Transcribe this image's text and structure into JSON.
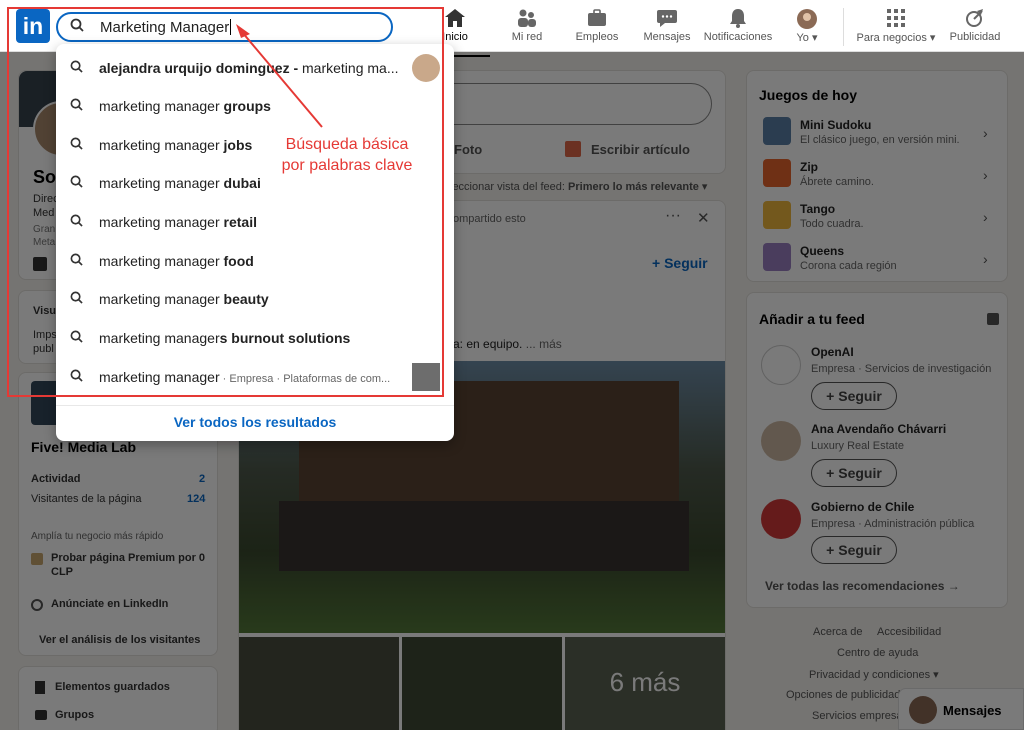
{
  "search": {
    "value": "Marketing Manager"
  },
  "nav": {
    "items": [
      {
        "label": "Inicio",
        "icon": "home-icon"
      },
      {
        "label": "Mi red",
        "icon": "network-icon"
      },
      {
        "label": "Empleos",
        "icon": "briefcase-icon"
      },
      {
        "label": "Mensajes",
        "icon": "chat-icon"
      },
      {
        "label": "Notificaciones",
        "icon": "bell-icon"
      },
      {
        "label": "Yo",
        "icon": "avatar-icon"
      },
      {
        "label": "Para negocios",
        "icon": "grid-icon"
      },
      {
        "label": "Publicidad",
        "icon": "compass-icon"
      }
    ]
  },
  "dropdown": {
    "suggestions": [
      {
        "prefix": "alejandra urquijo dominguez - ",
        "bold": "",
        "rest": "marketing ma...",
        "sub": ""
      },
      {
        "prefix": "marketing manager ",
        "bold": "groups",
        "rest": "",
        "sub": ""
      },
      {
        "prefix": "marketing manager ",
        "bold": "jobs",
        "rest": "",
        "sub": ""
      },
      {
        "prefix": "marketing manager ",
        "bold": "dubai",
        "rest": "",
        "sub": ""
      },
      {
        "prefix": "marketing manager ",
        "bold": "retail",
        "rest": "",
        "sub": ""
      },
      {
        "prefix": "marketing manager ",
        "bold": "food",
        "rest": "",
        "sub": ""
      },
      {
        "prefix": "marketing manager ",
        "bold": "beauty",
        "rest": "",
        "sub": ""
      },
      {
        "prefix": "marketing manager",
        "bold": "s burnout solutions",
        "rest": "",
        "sub": ""
      },
      {
        "prefix": "marketing manager",
        "bold": "",
        "rest": "",
        "sub": " · Empresa · Plataformas de com..."
      }
    ],
    "see_all": "Ver todos los resultados"
  },
  "annotation": "Búsqueda básica por palabras clave",
  "left": {
    "profile_name_partial": "So",
    "lines": [
      "Direc",
      "Med",
      "Gran",
      "Meta"
    ],
    "visu": "Visu",
    "imp": "Imps",
    "publ": "publ",
    "page_name": "Five! Media Lab",
    "activity_label": "Actividad",
    "activity_value": "2",
    "visitors_label": "Visitantes de la página",
    "visitors_value": "124",
    "grow_label": "Amplía tu negocio más rápido",
    "premium": "Probar página Premium por 0 CLP",
    "advertise": "Anúnciate en LinkedIn",
    "analysis": "Ver el análisis de los visitantes",
    "saved": "Elementos guardados",
    "groups": "Grupos"
  },
  "center": {
    "photo": "Foto",
    "article": "Escribir artículo",
    "feed_sort_label": "leccionar vista del feed:",
    "feed_sort_value": "Primero lo más relevante",
    "shared": "ompartido esto",
    "follow": "+ Seguir",
    "post_text": "a: en equipo.",
    "more": "... más",
    "more_photos": "6 más"
  },
  "right": {
    "games_title": "Juegos de hoy",
    "games": [
      {
        "name": "Mini Sudoku",
        "desc": "El clásico juego, en versión mini.",
        "color": "#5b7fa8"
      },
      {
        "name": "Zip",
        "desc": "Ábrete camino.",
        "color": "#e8642c"
      },
      {
        "name": "Tango",
        "desc": "Todo cuadra.",
        "color": "#f1b93d"
      },
      {
        "name": "Queens",
        "desc": "Corona cada región",
        "color": "#9b7fc3"
      }
    ],
    "feed_title": "Añadir a tu feed",
    "recs": [
      {
        "name": "OpenAI",
        "desc": "Empresa · Servicios de investigación",
        "follow": "+ Seguir"
      },
      {
        "name": "Ana Avendaño Chávarri",
        "desc": "Luxury Real Estate",
        "follow": "+ Seguir"
      },
      {
        "name": "Gobierno de Chile",
        "desc": "Empresa · Administración pública",
        "follow": "+ Seguir"
      }
    ],
    "see_all_recs": "Ver todas las recomendaciones →",
    "footer": [
      "Acerca de",
      "Accesibilidad",
      "Centro de ayuda",
      "Privacidad y condiciones ▾",
      "Opciones de publicidad",
      "Servicios empresa"
    ],
    "messages": "Mensajes"
  }
}
